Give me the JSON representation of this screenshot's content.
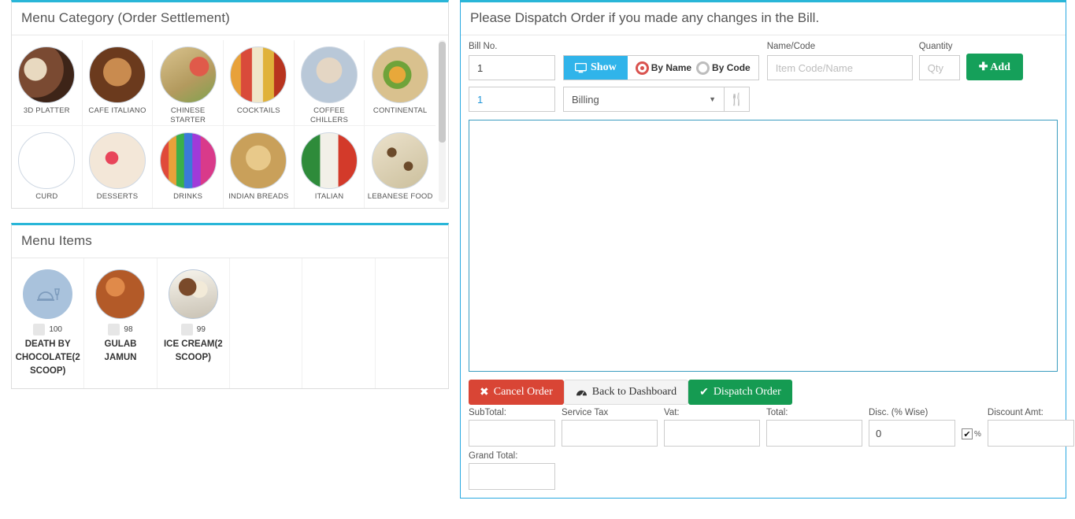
{
  "left": {
    "category_panel": {
      "title": "Menu Category (Order Settlement)",
      "categories": [
        {
          "label": "3D PLATTER",
          "image": "platter-image"
        },
        {
          "label": "CAFE ITALIANO",
          "image": "coffee-cup-image"
        },
        {
          "label": "CHINESE STARTER",
          "image": "spring-rolls-image"
        },
        {
          "label": "COCKTAILS",
          "image": "cocktails-image"
        },
        {
          "label": "COFFEE CHILLERS",
          "image": "coffee-shake-image"
        },
        {
          "label": "CONTINENTAL",
          "image": "continental-dish-image"
        },
        {
          "label": "CURD",
          "image": "curd-pot-image"
        },
        {
          "label": "DESSERTS",
          "image": "desserts-image"
        },
        {
          "label": "DRINKS",
          "image": "drinks-image"
        },
        {
          "label": "INDIAN BREADS",
          "image": "indian-breads-image"
        },
        {
          "label": "ITALIAN",
          "image": "italian-flag-salad-image"
        },
        {
          "label": "LEBANESE FOOD",
          "image": "lebanese-food-image"
        }
      ]
    },
    "items_panel": {
      "title": "Menu Items",
      "items": [
        {
          "label": "DEATH BY CHOCOLATE(2 SCOOP)",
          "price": "100",
          "image": "placeholder-icon"
        },
        {
          "label": "GULAB JAMUN",
          "price": "98",
          "image": "gulab-jamun-image"
        },
        {
          "label": "ICE CREAM(2 SCOOP)",
          "price": "99",
          "image": "ice-cream-image"
        }
      ]
    }
  },
  "right": {
    "title": "Please Dispatch Order if you made any changes in the Bill.",
    "bill_no": {
      "label": "Bill No.",
      "value": "1"
    },
    "show_button": {
      "label": "Show",
      "icon": "monitor-icon"
    },
    "search_mode": {
      "by_name": {
        "label": "By Name",
        "selected": true
      },
      "by_code": {
        "label": "By Code",
        "selected": false
      }
    },
    "name_code": {
      "label": "Name/Code",
      "placeholder": "Item Code/Name",
      "value": ""
    },
    "quantity": {
      "label": "Quantity",
      "placeholder": "Qty",
      "value": ""
    },
    "add_button": {
      "label": "Add",
      "icon": "plus-icon"
    },
    "table_no": {
      "value": "1"
    },
    "order_type": {
      "selected": "Billing",
      "options": [
        "Billing"
      ]
    },
    "fork_button": {
      "icon": "fork-knife-icon"
    },
    "actions": {
      "cancel": {
        "label": "Cancel Order",
        "icon": "times-icon"
      },
      "dashboard": {
        "label": "Back to Dashboard",
        "icon": "dashboard-icon"
      },
      "dispatch": {
        "label": "Dispatch Order",
        "icon": "check-icon"
      }
    },
    "totals": {
      "subtotal": {
        "label": "SubTotal:",
        "value": ""
      },
      "service_tax": {
        "label": "Service Tax",
        "value": ""
      },
      "vat": {
        "label": "Vat:",
        "value": ""
      },
      "total": {
        "label": "Total:",
        "value": ""
      },
      "discount_pct": {
        "label": "Disc. (% Wise)",
        "value": "0"
      },
      "pct_checkbox": {
        "checked": true,
        "suffix": "%"
      },
      "discount_amt": {
        "label": "Discount Amt:",
        "value": ""
      },
      "grand_total": {
        "label": "Grand Total:",
        "value": ""
      }
    }
  },
  "colors": {
    "accent_cyan": "#29b6d8",
    "show_blue": "#30b4ea",
    "add_green": "#15a05a",
    "cancel_red": "#d94535",
    "dispatch_green": "#159b52",
    "radio_red": "#d9534f",
    "panel_border": "#29a8e0"
  }
}
